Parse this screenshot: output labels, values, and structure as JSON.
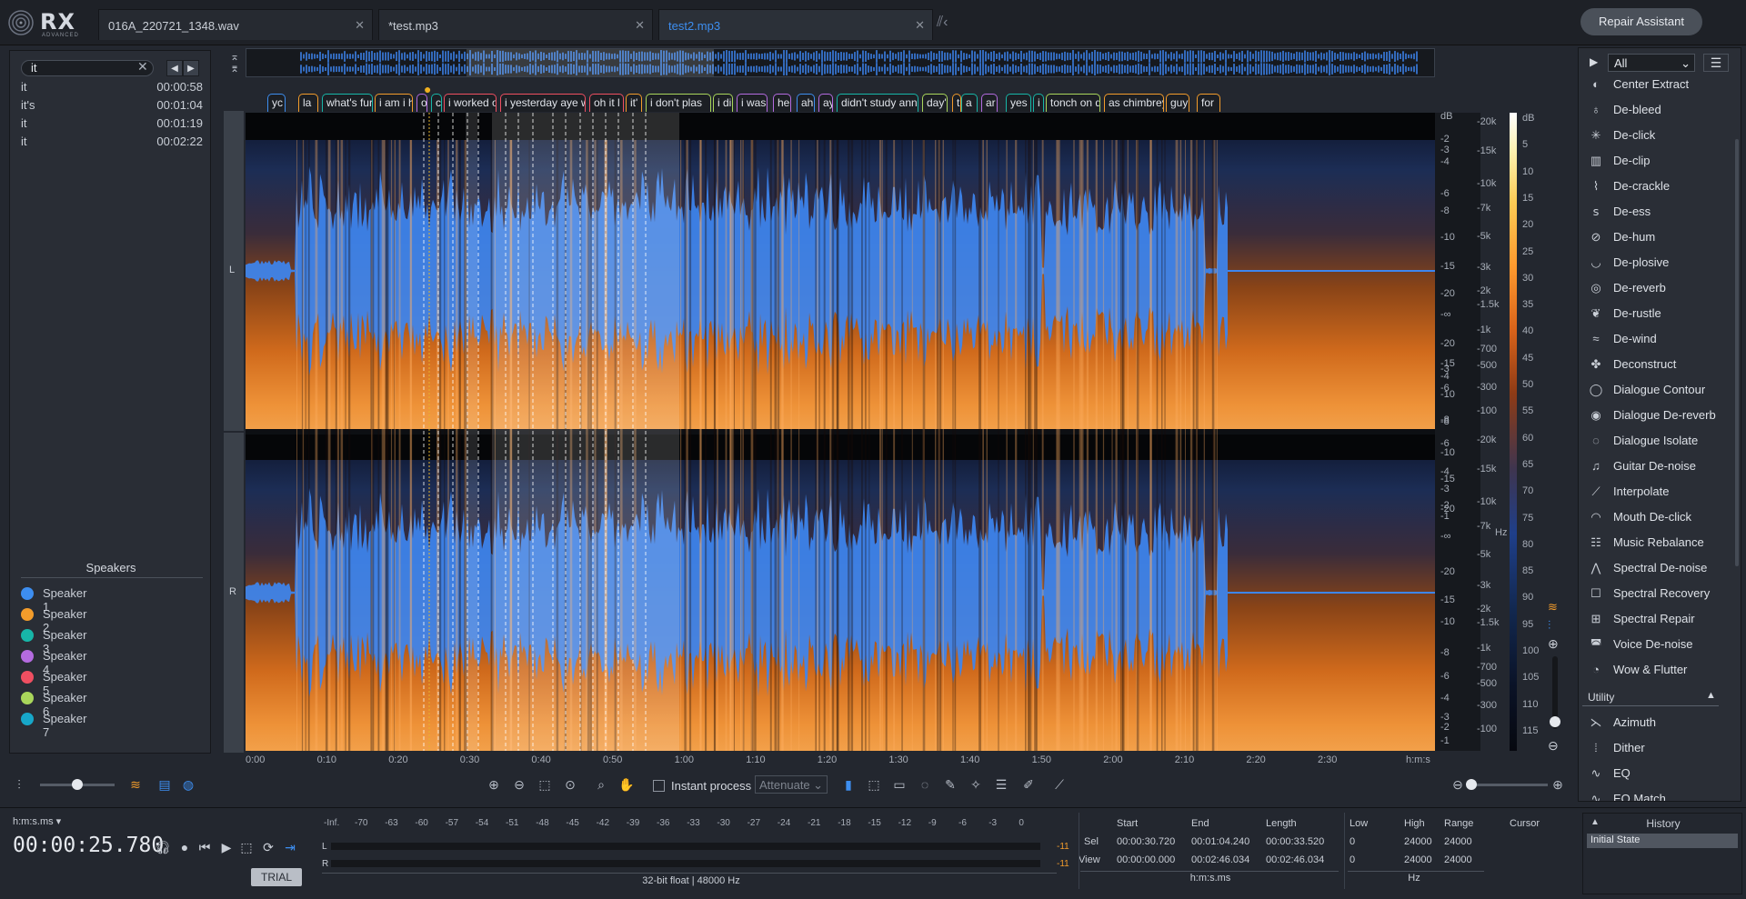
{
  "app": {
    "logo_text": "RX",
    "logo_sub": "ADVANCED"
  },
  "tabs": [
    {
      "label": "016A_220721_1348.wav"
    },
    {
      "label": "*test.mp3"
    },
    {
      "label": "test2.mp3"
    }
  ],
  "repair_assistant": "Repair Assistant",
  "search": {
    "value": "it",
    "results": [
      {
        "word": "it",
        "time": "00:00:58"
      },
      {
        "word": "it's",
        "time": "00:01:04"
      },
      {
        "word": "it",
        "time": "00:01:19"
      },
      {
        "word": "it",
        "time": "00:02:22"
      }
    ]
  },
  "speakers": {
    "title": "Speakers",
    "items": [
      {
        "name": "Speaker 1",
        "color": "#3d8ef0"
      },
      {
        "name": "Speaker 2",
        "color": "#f39c2b"
      },
      {
        "name": "Speaker 3",
        "color": "#17b6a8"
      },
      {
        "name": "Speaker 4",
        "color": "#b46be0"
      },
      {
        "name": "Speaker 5",
        "color": "#ef4f61"
      },
      {
        "name": "Speaker 6",
        "color": "#a9d65b"
      },
      {
        "name": "Speaker 7",
        "color": "#17a7c9"
      }
    ]
  },
  "transcript_labels": [
    "yc",
    "la",
    "what's fur",
    "i am i ha",
    "o",
    "c",
    "i worked o",
    "i yesterday aye wo",
    "oh it l",
    "it'",
    "i don't plas",
    "i di",
    "i was",
    "he",
    "ah",
    "ay",
    "didn't study anne a",
    "day'",
    "t",
    "a",
    "ar",
    "yes",
    "i h",
    "tonch on d",
    "as chimbrey",
    "guy s",
    "for"
  ],
  "channels": {
    "left": "L",
    "right": "R"
  },
  "db_scale": [
    "dB",
    "-2",
    "-3",
    "-4",
    "-6",
    "-8",
    "-10",
    "-15",
    "-20",
    "-∞",
    "-20",
    "-15",
    "-10",
    "-8",
    "-6",
    "-4",
    "-3",
    "-2",
    "-1"
  ],
  "hz_scale": [
    "-20k",
    "-15k",
    "-10k",
    "-7k",
    "-5k",
    "-3k",
    "-2k",
    "-1.5k",
    "-1k",
    "-700",
    "-500",
    "-300",
    "-100",
    "Hz"
  ],
  "colorbar_scale": [
    "dB",
    "5",
    "10",
    "15",
    "20",
    "25",
    "30",
    "35",
    "40",
    "45",
    "50",
    "55",
    "60",
    "65",
    "70",
    "75",
    "80",
    "85",
    "90",
    "95",
    "100",
    "105",
    "110",
    "115"
  ],
  "timeline": [
    "0:00",
    "0:10",
    "0:20",
    "0:30",
    "0:40",
    "0:50",
    "1:00",
    "1:10",
    "1:20",
    "1:30",
    "1:40",
    "1:50",
    "2:00",
    "2:10",
    "2:20",
    "2:30",
    "h:m:s"
  ],
  "toolbar": {
    "instant_process": "Instant process",
    "attenuate": "Attenuate"
  },
  "modules": {
    "filter": "All",
    "repair": [
      "Center Extract",
      "De-bleed",
      "De-click",
      "De-clip",
      "De-crackle",
      "De-ess",
      "De-hum",
      "De-plosive",
      "De-reverb",
      "De-rustle",
      "De-wind",
      "Deconstruct",
      "Dialogue Contour",
      "Dialogue De-reverb",
      "Dialogue Isolate",
      "Guitar De-noise",
      "Interpolate",
      "Mouth De-click",
      "Music Rebalance",
      "Spectral De-noise",
      "Spectral Recovery",
      "Spectral Repair",
      "Voice De-noise",
      "Wow & Flutter"
    ],
    "utility_label": "Utility",
    "utility": [
      "Azimuth",
      "Dither",
      "EQ",
      "EQ Match"
    ]
  },
  "transport": {
    "format": "h:m:s.ms",
    "time": "00:00:25.780",
    "trial": "TRIAL"
  },
  "meter": {
    "scale": [
      "-Inf.",
      "-70",
      "-63",
      "-60",
      "-57",
      "-54",
      "-51",
      "-48",
      "-45",
      "-42",
      "-39",
      "-36",
      "-33",
      "-30",
      "-27",
      "-24",
      "-21",
      "-18",
      "-15",
      "-12",
      "-9",
      "-6",
      "-3",
      "0"
    ],
    "peak_l": "-11",
    "peak_r": "-11",
    "format": "32-bit float | 48000 Hz"
  },
  "selection": {
    "headers": [
      "Start",
      "End",
      "Length"
    ],
    "sel_label": "Sel",
    "view_label": "View",
    "sel": [
      "00:00:30.720",
      "00:01:04.240",
      "00:00:33.520"
    ],
    "view": [
      "00:00:00.000",
      "00:02:46.034",
      "00:02:46.034"
    ],
    "unit": "h:m:s.ms"
  },
  "frequency": {
    "headers": [
      "Low",
      "High",
      "Range",
      "Cursor"
    ],
    "sel": [
      "0",
      "24000",
      "24000"
    ],
    "view": [
      "0",
      "24000",
      "24000"
    ],
    "unit": "Hz"
  },
  "history": {
    "title": "History",
    "items": [
      "Initial State"
    ]
  }
}
